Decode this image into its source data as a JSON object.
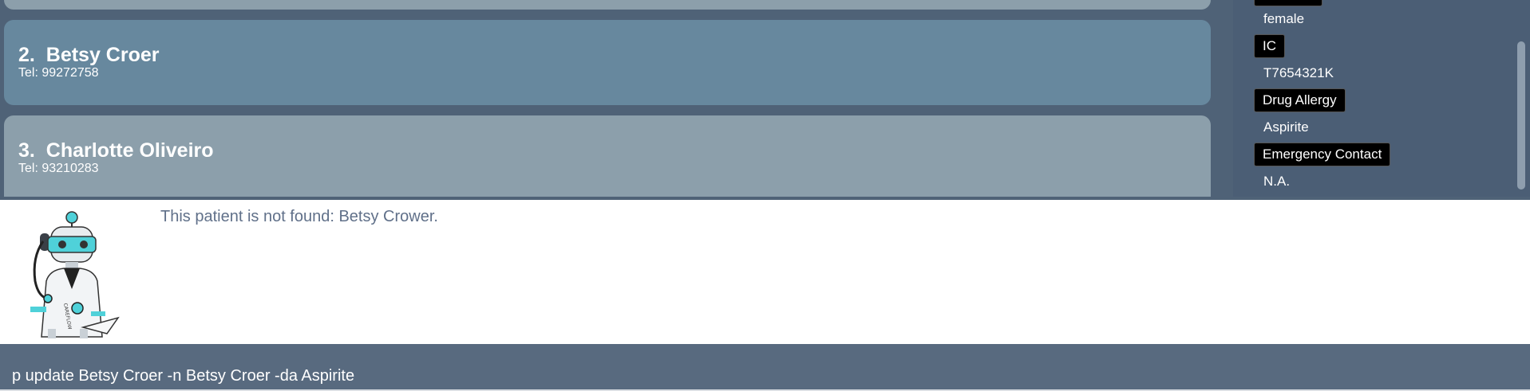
{
  "patients": [
    {
      "index": "2.",
      "name": "Betsy Croer",
      "tel": "Tel: 99272758"
    },
    {
      "index": "3.",
      "name": "Charlotte Oliveiro",
      "tel": "Tel: 93210283"
    }
  ],
  "details": {
    "gender_value": "female",
    "ic_label": "IC",
    "ic_value": "T7654321K",
    "allergy_label": "Drug Allergy",
    "allergy_value": "Aspirite",
    "contact_label": "Emergency Contact",
    "contact_value": "N.A."
  },
  "result": {
    "message": "This patient is not found: Betsy Crower.",
    "mascot_text": "CAREFLOW"
  },
  "command": {
    "value": "p update Betsy Croer -n Betsy Croer -da Aspirite"
  },
  "colors": {
    "selected_card": "#67889e",
    "card": "#8c9fab",
    "background": "#4f6277",
    "accent": "#4fd1d9"
  }
}
